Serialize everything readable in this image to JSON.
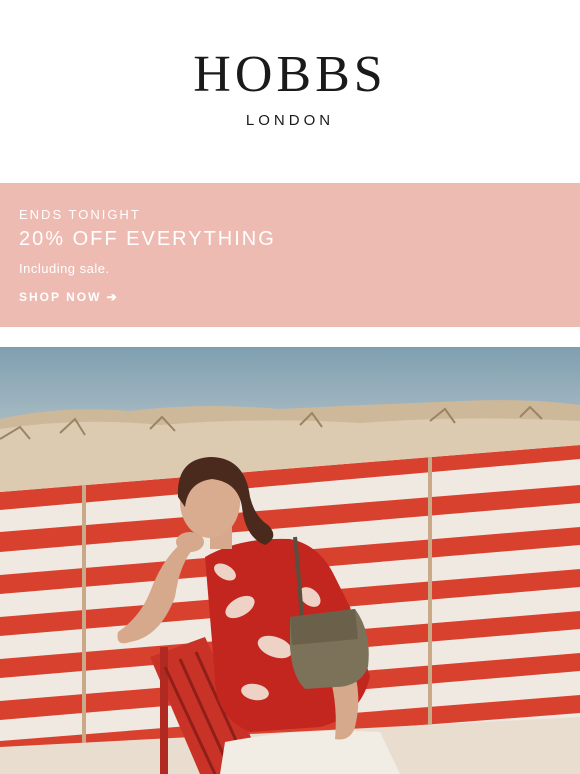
{
  "header": {
    "logo_main": "HOBBS",
    "logo_sub": "LONDON"
  },
  "banner": {
    "eyebrow": "ENDS TONIGHT",
    "headline": "20% OFF EVERYTHING",
    "subtext": "Including sale.",
    "cta_label": "SHOP NOW ➔",
    "background_color": "#eebbb2",
    "text_color": "#ffffff"
  },
  "hero": {
    "image": "beach-photo-woman-striped-windbreak",
    "colors": {
      "sky": "#8eaab8",
      "sand": "#e9ddd0",
      "stripe_red": "#d9412f",
      "stripe_white": "#efe9e2"
    }
  }
}
